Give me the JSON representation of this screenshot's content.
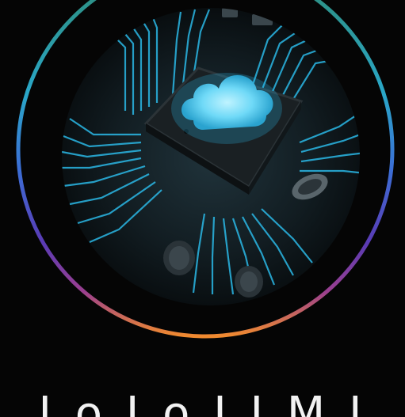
{
  "image": {
    "subject": "circuit-board-chip-with-glowing-cloud",
    "ring_gradient_colors": [
      "#2e8a72",
      "#2aa7c8",
      "#3b6fd6",
      "#5a3bb5",
      "#9a3f8f",
      "#d9673a",
      "#f08a2f"
    ],
    "trace_color": "#2bb8e6",
    "cloud_color": "#7fe3ff"
  },
  "caption": {
    "text": "I o I o I I M I"
  }
}
